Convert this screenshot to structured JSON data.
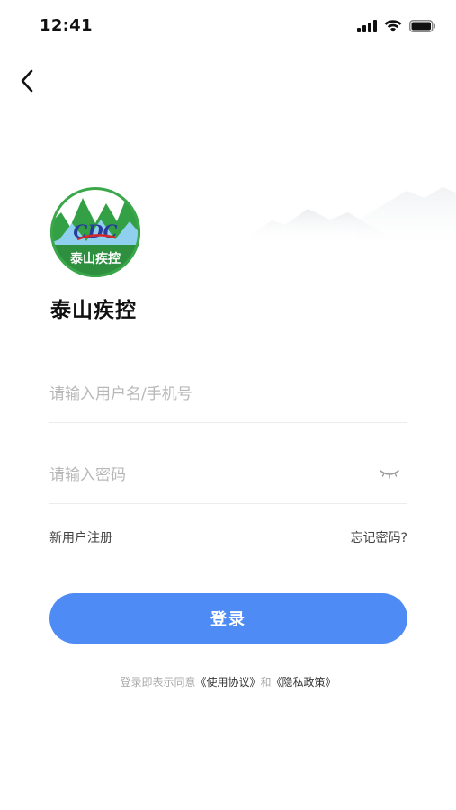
{
  "status_bar": {
    "time": "12:41"
  },
  "brand": {
    "name": "泰山疾控",
    "logo_text": "泰山疾控",
    "logo_mark": "CDC",
    "logo_colors": {
      "ring": "#3aa84a",
      "sky": "#ffffff",
      "mountain": "#2f9a45",
      "banner": "#2b8a3e",
      "mark_blue": "#2a3b9c",
      "mark_red": "#d6282a"
    }
  },
  "form": {
    "username_placeholder": "请输入用户名/手机号",
    "username_value": "",
    "password_placeholder": "请输入密码",
    "password_value": ""
  },
  "links": {
    "register": "新用户注册",
    "forgot_password": "忘记密码?"
  },
  "login_button": {
    "label": "登录",
    "color": "#4e8bf5"
  },
  "agreement": {
    "prefix": "登录即表示同意",
    "terms": "《使用协议》",
    "conjunction": "和",
    "privacy": "《隐私政策》"
  },
  "icons": {
    "back": "chevron-left-icon",
    "signal": "cellular-signal-icon",
    "wifi": "wifi-icon",
    "battery": "battery-icon",
    "password_visibility": "eye-closed-icon"
  }
}
